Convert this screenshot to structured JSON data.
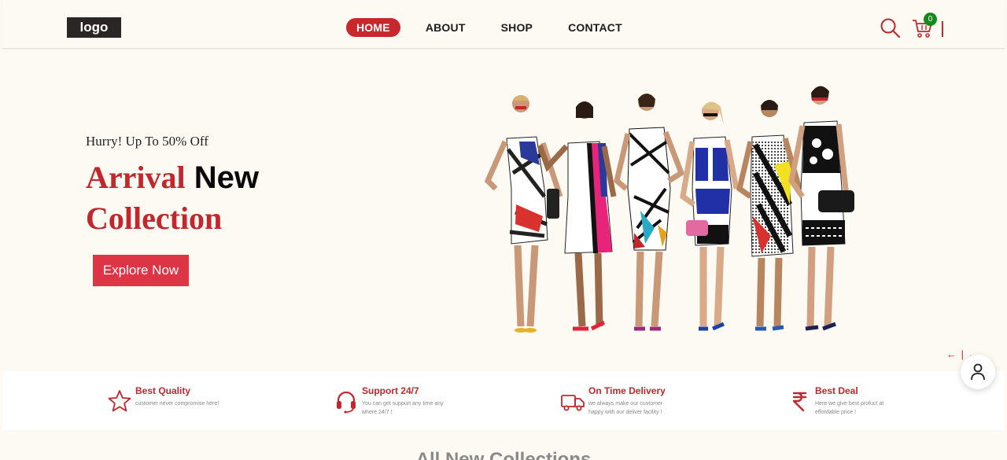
{
  "header": {
    "logo_text": "logo",
    "nav": [
      {
        "label": "HOME",
        "active": true
      },
      {
        "label": "ABOUT",
        "active": false
      },
      {
        "label": "SHOP",
        "active": false
      },
      {
        "label": "CONTACT",
        "active": false
      }
    ],
    "cart_count": "0",
    "icons": [
      "search-icon",
      "cart-icon"
    ]
  },
  "hero": {
    "subtitle": "Hurry! Up To 50% Off",
    "title_part1": "Arrival",
    "title_part2": "New",
    "title_part3": "Collection",
    "button_label": "Explore Now",
    "slider_arrows": "← | →",
    "image": "group-of-six-women-in-patterned-dresses"
  },
  "features": [
    {
      "icon": "star-icon",
      "title": "Best Quality",
      "desc": "customer never compromise here!"
    },
    {
      "icon": "headset-icon",
      "title": "Support 24/7",
      "desc": "You can get suppurt any time any where 24/7 !"
    },
    {
      "icon": "truck-icon",
      "title": "On Time Delivery",
      "desc": "we always make our customer happy with our deliver facility !"
    },
    {
      "icon": "rupee-icon",
      "title": "Best Deal",
      "desc": "Here we give best profuct at effordable price !"
    }
  ],
  "section": {
    "title": "All New Collections"
  },
  "colors": {
    "accent": "#c1272d",
    "button": "#dc3545",
    "background": "#fdfaf4",
    "badge": "#138a1b"
  }
}
